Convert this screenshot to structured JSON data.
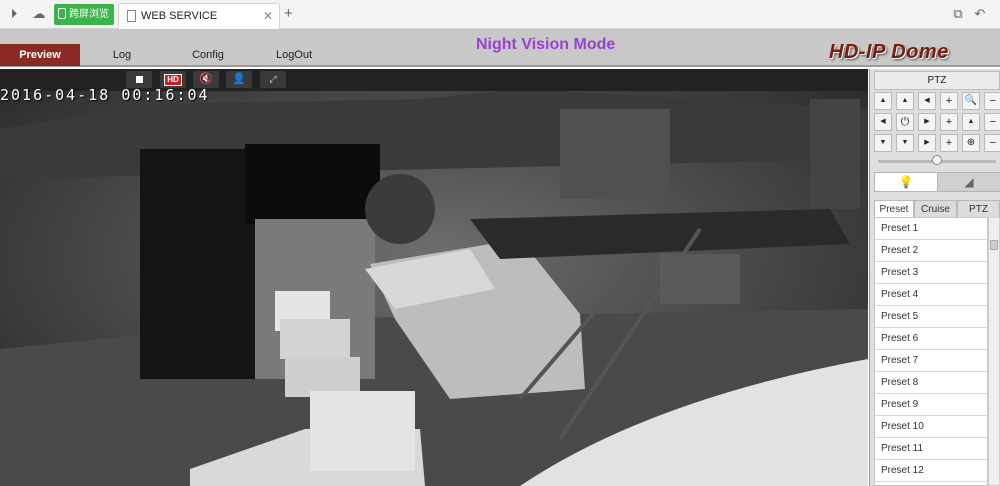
{
  "browser": {
    "special_tab_label": "跨屏浏览",
    "tab_title": "WEB SERVICE"
  },
  "nav": {
    "preview": "Preview",
    "log": "Log",
    "config": "Config",
    "logout": "LogOut"
  },
  "header": {
    "mode_title": "Night Vision Mode",
    "brand": "HD-IP Dome"
  },
  "video": {
    "hd_badge": "HD",
    "timestamp": "2016-04-18  00:16:04"
  },
  "ptz": {
    "header": "PTZ",
    "tabs": [
      "Preset",
      "Cruise",
      "PTZ"
    ],
    "active_tab": "Preset",
    "presets": [
      "Preset  1",
      "Preset  2",
      "Preset  3",
      "Preset  4",
      "Preset  5",
      "Preset  6",
      "Preset  7",
      "Preset  8",
      "Preset  9",
      "Preset  10",
      "Preset  11",
      "Preset  12"
    ],
    "speed_level": 0.5
  },
  "colors": {
    "nav_active": "#8b2a22",
    "mode_title": "#9a3fd0",
    "brand": "#7a1c14",
    "special_tab": "#3cb44b"
  }
}
